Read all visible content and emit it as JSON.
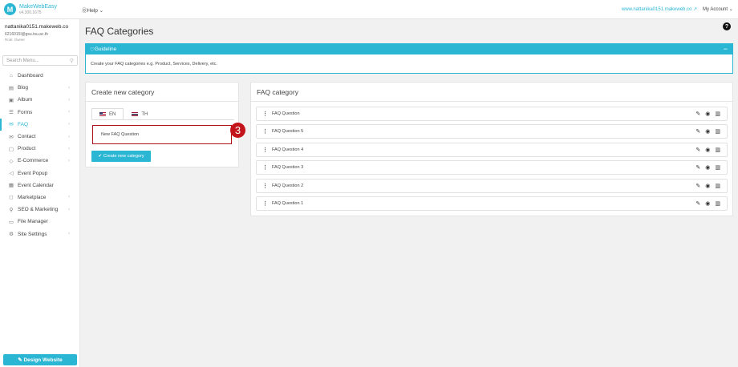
{
  "topbar": {
    "brand": "MakeWebEasy",
    "version": "v4.300.1675",
    "help": "Help",
    "site_link": "www.nattanika0151.makeweb.co",
    "account": "My Account"
  },
  "sidebar": {
    "user_name": "nattanika0151.makeweb.co",
    "user_email": "6216015l@gsu.tsu.ac.th",
    "user_role": "Role: Owner",
    "search_placeholder": "Search Menu...",
    "items": [
      {
        "label": "Dashboard",
        "icon": "home-icon",
        "glyph": "⌂",
        "chevron": false
      },
      {
        "label": "Blog",
        "icon": "document-icon",
        "glyph": "▤",
        "chevron": true
      },
      {
        "label": "Album",
        "icon": "image-icon",
        "glyph": "▣",
        "chevron": true
      },
      {
        "label": "Forms",
        "icon": "list-icon",
        "glyph": "☰",
        "chevron": true
      },
      {
        "label": "FAQ",
        "icon": "chat-icon",
        "glyph": "✉",
        "chevron": true
      },
      {
        "label": "Contact",
        "icon": "mail-icon",
        "glyph": "✉",
        "chevron": true
      },
      {
        "label": "Product",
        "icon": "box-icon",
        "glyph": "▢",
        "chevron": true
      },
      {
        "label": "E-Commerce",
        "icon": "tag-icon",
        "glyph": "◇",
        "chevron": true
      },
      {
        "label": "Event Popup",
        "icon": "megaphone-icon",
        "glyph": "◁",
        "chevron": false
      },
      {
        "label": "Event Calendar",
        "icon": "calendar-icon",
        "glyph": "▦",
        "chevron": false
      },
      {
        "label": "Marketplace",
        "icon": "bag-icon",
        "glyph": "◻",
        "chevron": true
      },
      {
        "label": "SEO & Marketing",
        "icon": "search-icon",
        "glyph": "⚲",
        "chevron": true
      },
      {
        "label": "File Manager",
        "icon": "folder-icon",
        "glyph": "▭",
        "chevron": false
      },
      {
        "label": "Site Settings",
        "icon": "gear-icon",
        "glyph": "⚙",
        "chevron": true
      }
    ],
    "active_index": 4,
    "design_button": "Design Website"
  },
  "page": {
    "title": "FAQ Categories",
    "guideline_title": "Guideline",
    "guideline_text": "Create your FAQ categories e.g. Product, Services, Delivery, etc."
  },
  "create": {
    "title": "Create new category",
    "tabs": [
      "EN",
      "TH"
    ],
    "input_value": "New FAQ Question",
    "step_badge": "3",
    "button": "Create new category"
  },
  "categories": {
    "title": "FAQ category",
    "items": [
      "FAQ Question",
      "FAQ Question 5",
      "FAQ Question 4",
      "FAQ Question 3",
      "FAQ Question 2",
      "FAQ Question 1"
    ]
  },
  "colors": {
    "accent": "#2bb6d4",
    "highlight": "#c4141b"
  }
}
